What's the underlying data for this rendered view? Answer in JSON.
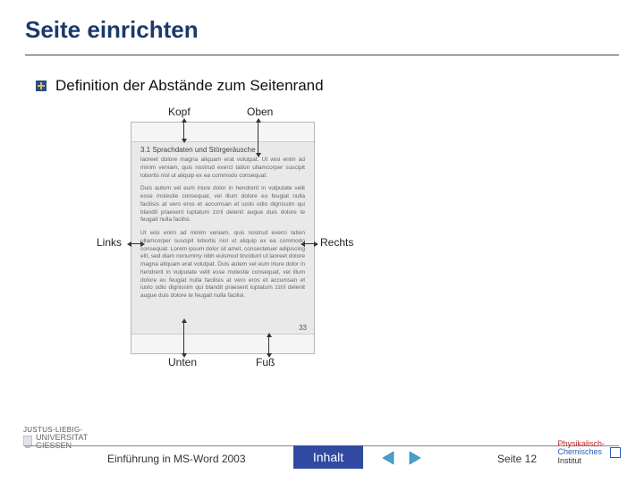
{
  "title": "Seite einrichten",
  "bullet": "Definition der Abstände zum Seitenrand",
  "figure": {
    "labels": {
      "kopf": "Kopf",
      "oben": "Oben",
      "links": "Links",
      "rechts": "Rechts",
      "unten": "Unten",
      "fuss": "Fuß"
    },
    "sample_heading": "3.1 Sprachdaten und Störgeräusche",
    "sample_paragraphs": [
      "laoreet dolore magna aliquam erat volutpat. Ut wisi enim ad minim veniam, quis nostrud exerci tation ullamcorper suscipit lobortis nisl ut aliquip ex ea commodo consequat.",
      "Duis autem vel eum iriure dolor in hendrerit in vulputate velit esse molestie consequat, vel illum dolore eu feugiat nulla facilisis at vero eros et accumsan et iusto odio dignissim qui blandit praesent luptatum zzril delenit augue duis dolore te feugait nulla facilisi.",
      "Ut wisi enim ad minim veniam, quis nostrud exerci tation ullamcorper suscipit lobortis nisl ut aliquip ex ea commodo consequat. Lorem ipsum dolor sit amet, consectetuer adipiscing elit, sed diam nonummy nibh euismod tincidunt ut laoreet dolore magna aliquam erat volutpat. Duis autem vel eum iriure dolor in hendrerit in vulputate velit esse molestie consequat, vel illum dolore eu feugiat nulla facilisis at vero eros et accumsan et iusto odio dignissim qui blandit praesent luptatum zzril delenit augue duis dolore te feugait nulla facilisi."
    ],
    "page_number": "33"
  },
  "footer": {
    "logo_left_top": "JUSTUS-LIEBIG-",
    "logo_left_main": "UNIVERSITAT\nGIESSEN",
    "course": "Einführung in MS-Word 2003",
    "inhalt_button": "Inhalt",
    "page_label": "Seite 12",
    "logo_right_line1": "Physikalisch-",
    "logo_right_line2": "Chemisches",
    "logo_right_line3": "Institut"
  }
}
